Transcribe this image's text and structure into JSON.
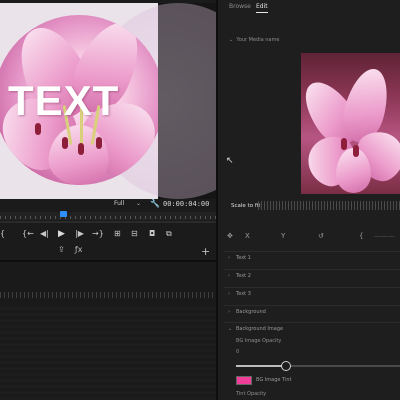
{
  "program_monitor": {
    "overlay_text": "TEXT",
    "fit_label": "Full",
    "timecode": "00:00:04:00",
    "playhead_fraction": 0.29
  },
  "transport": {
    "buttons": [
      {
        "icon": "mark-in-icon",
        "glyph": "{"
      },
      {
        "icon": "go-to-in-icon",
        "glyph": "{←"
      },
      {
        "icon": "step-back-icon",
        "glyph": "◀|"
      },
      {
        "icon": "play-icon",
        "glyph": "▶"
      },
      {
        "icon": "step-forward-icon",
        "glyph": "|▶"
      },
      {
        "icon": "go-to-out-icon",
        "glyph": "→}"
      },
      {
        "icon": "insert-icon",
        "glyph": "⊞"
      },
      {
        "icon": "overwrite-icon",
        "glyph": "⊟"
      },
      {
        "icon": "camera-icon",
        "glyph": "◘"
      },
      {
        "icon": "compare-icon",
        "glyph": "⧉"
      }
    ],
    "export_glyph": "⇪",
    "fx_glyph": "ƒx",
    "add_glyph": "+"
  },
  "right_panel": {
    "tabs": [
      {
        "label": "Browse",
        "active": false
      },
      {
        "label": "Edit",
        "active": true
      }
    ],
    "media_section_label": "Your Media name",
    "scale_label": "Scale to fit",
    "properties": [
      {
        "label": "Text 1",
        "expanded": false
      },
      {
        "label": "Text 2",
        "expanded": false
      },
      {
        "label": "Text 3",
        "expanded": false
      },
      {
        "label": "Background",
        "expanded": false
      },
      {
        "label": "Background Image",
        "expanded": true
      }
    ],
    "bg_image_opacity_label": "BG Image Opacity",
    "bg_image_opacity_value": "0",
    "bg_image_opacity_slider": 0.3,
    "bg_image_tint_label": "BG Image Tint",
    "bg_image_tint_color": "#ef3e98",
    "tint_opacity_label": "Tint Opacity"
  }
}
